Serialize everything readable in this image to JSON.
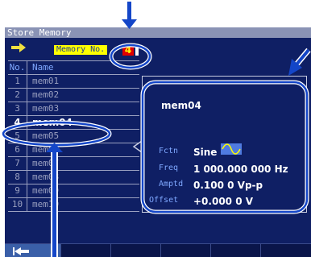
{
  "title": "Store Memory",
  "memory_no_label": "Memory No.",
  "memory_no_value": "4",
  "table": {
    "headers": {
      "no": "No.",
      "name": "Name"
    },
    "rows": [
      {
        "no": "1",
        "name": "mem01"
      },
      {
        "no": "2",
        "name": "mem02"
      },
      {
        "no": "3",
        "name": "mem03"
      },
      {
        "no": "4",
        "name": "mem04"
      },
      {
        "no": "5",
        "name": "mem05"
      },
      {
        "no": "6",
        "name": "mem06"
      },
      {
        "no": "7",
        "name": "mem07"
      },
      {
        "no": "8",
        "name": "mem08"
      },
      {
        "no": "9",
        "name": "mem09"
      },
      {
        "no": "10",
        "name": "mem10"
      }
    ],
    "selected_index": 3
  },
  "info": {
    "name": "mem04",
    "params": [
      {
        "label": "Fctn",
        "value": "Sine",
        "icon": "sine-wave-icon"
      },
      {
        "label": "Freq",
        "value": "1 000.000 000 Hz"
      },
      {
        "label": "Amptd",
        "value": "0.100 0 Vp-p"
      },
      {
        "label": "Offset",
        "value": "+0.000 0 V"
      }
    ]
  },
  "colors": {
    "screen_bg": "#0f1f64",
    "annotation": "#1446c8",
    "highlight": "#ffff00",
    "value_box": "#e00000"
  }
}
